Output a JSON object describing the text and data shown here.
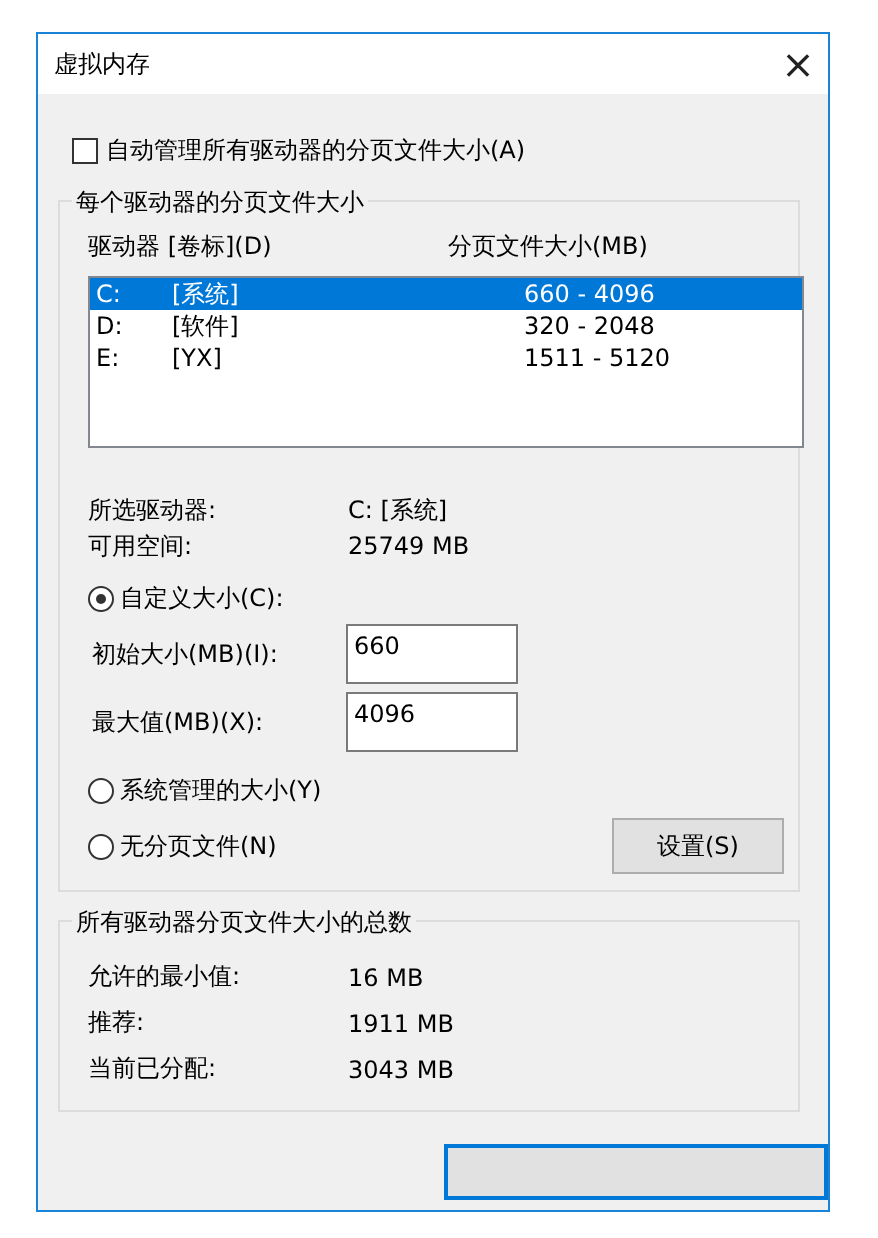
{
  "window": {
    "title": "虚拟内存",
    "close": "×"
  },
  "auto_manage": {
    "label": "自动管理所有驱动器的分页文件大小(A)",
    "checked": false
  },
  "per_drive": {
    "title": "每个驱动器的分页文件大小",
    "columns": [
      "驱动器 [卷标](D)",
      "分页文件大小(MB)"
    ],
    "rows": [
      {
        "drive": "C:",
        "label": "[系统]",
        "size": "660 - 4096",
        "selected": true
      },
      {
        "drive": "D:",
        "label": "[软件]",
        "size": "320 - 2048",
        "selected": false
      },
      {
        "drive": "E:",
        "label": "[YX]",
        "size": "1511 - 5120",
        "selected": false
      }
    ],
    "info": [
      {
        "label": "所选驱动器:",
        "value": "C:  [系统]"
      },
      {
        "label": "可用空间:",
        "value": "25749 MB"
      }
    ],
    "custom": {
      "label": "自定义大小(C):",
      "selected": true
    },
    "fields": [
      {
        "label": "初始大小(MB)(I):",
        "value": "660"
      },
      {
        "label": "最大值(MB)(X):",
        "value": "4096"
      }
    ],
    "system_managed": {
      "label": "系统管理的大小(Y)",
      "selected": false
    },
    "no_paging": {
      "label": "无分页文件(N)",
      "selected": false
    },
    "set_button": "设置(S)"
  },
  "totals": {
    "title": "所有驱动器分页文件大小的总数",
    "rows": [
      {
        "label": "允许的最小值:",
        "value": "16 MB"
      },
      {
        "label": "推荐:",
        "value": "1911 MB"
      },
      {
        "label": "当前已分配:",
        "value": "3043 MB"
      }
    ]
  }
}
